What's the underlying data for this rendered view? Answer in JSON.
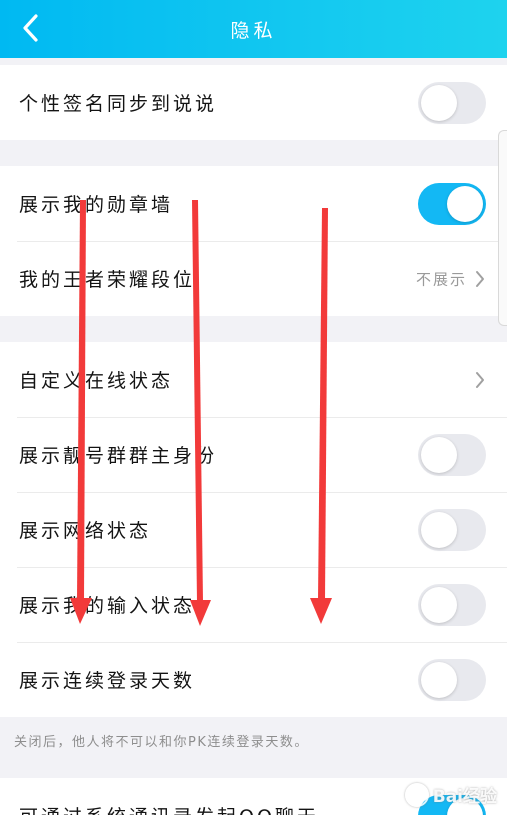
{
  "header": {
    "title": "隐私"
  },
  "groups": [
    {
      "rows": [
        {
          "label": "个性签名同步到说说",
          "control": "toggle",
          "on": false
        }
      ]
    },
    {
      "rows": [
        {
          "label": "展示我的勋章墙",
          "control": "toggle",
          "on": true
        },
        {
          "label": "我的王者荣耀段位",
          "control": "value",
          "value": "不展示"
        }
      ]
    },
    {
      "rows": [
        {
          "label": "自定义在线状态",
          "control": "chevron"
        },
        {
          "label": "展示靓号群群主身份",
          "control": "toggle",
          "on": false
        },
        {
          "label": "展示网络状态",
          "control": "toggle",
          "on": false
        },
        {
          "label": "展示我的输入状态",
          "control": "toggle",
          "on": false
        },
        {
          "label": "展示连续登录天数",
          "control": "toggle",
          "on": false
        }
      ]
    },
    {
      "rows": [
        {
          "label": "可通过系统通讯录发起QQ聊天",
          "control": "toggle",
          "on": true
        }
      ]
    }
  ],
  "footnote": "关闭后，他人将不可以和你PK连续登录天数。",
  "watermark": "Bai经验",
  "colors": {
    "header": "#12c7f0",
    "toggle_on": "#13b8f4",
    "arrow": "#f23a3a"
  }
}
